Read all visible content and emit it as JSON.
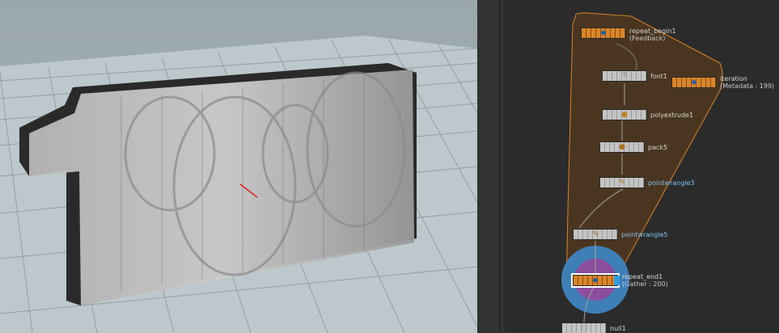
{
  "nodes": {
    "repeat_begin1": {
      "name": "repeat_begin1",
      "detail": "(Feedback)"
    },
    "font1": {
      "name": "font1"
    },
    "iteration": {
      "name": "iteration",
      "detail": "(Metadata : 199)"
    },
    "polyextrude1": {
      "name": "polyextrude1"
    },
    "pack5": {
      "name": "pack5"
    },
    "pointwrangle3": {
      "name": "pointwrangle3"
    },
    "pointwrangle5": {
      "name": "pointwrangle5"
    },
    "repeat_end1": {
      "name": "repeat_end1",
      "detail": "(Gather : 200)"
    },
    "null1": {
      "name": "null1"
    }
  },
  "colors": {
    "loop_block_fill": "#4a3620",
    "loop_block_border": "#d8822a",
    "compile_node": "#d9862a",
    "node_gray": "#c4c4c4",
    "label_highlight": "#7ec4f2",
    "display_ring": "#3f7fb8",
    "display_inner": "#8a4e9c",
    "viewport_sky": "#9eaab0",
    "viewport_ground": "#bcc8cb"
  },
  "icons": {
    "repeat_begin1": "loop-begin-icon",
    "font1": "font-T-icon",
    "iteration": "metadata-icon",
    "polyextrude1": "polyextrude-icon",
    "pack5": "pack-icon",
    "pointwrangle3": "wrangle-icon",
    "pointwrangle5": "wrangle-icon",
    "repeat_end1": "loop-end-icon",
    "null1": "null-icon"
  }
}
